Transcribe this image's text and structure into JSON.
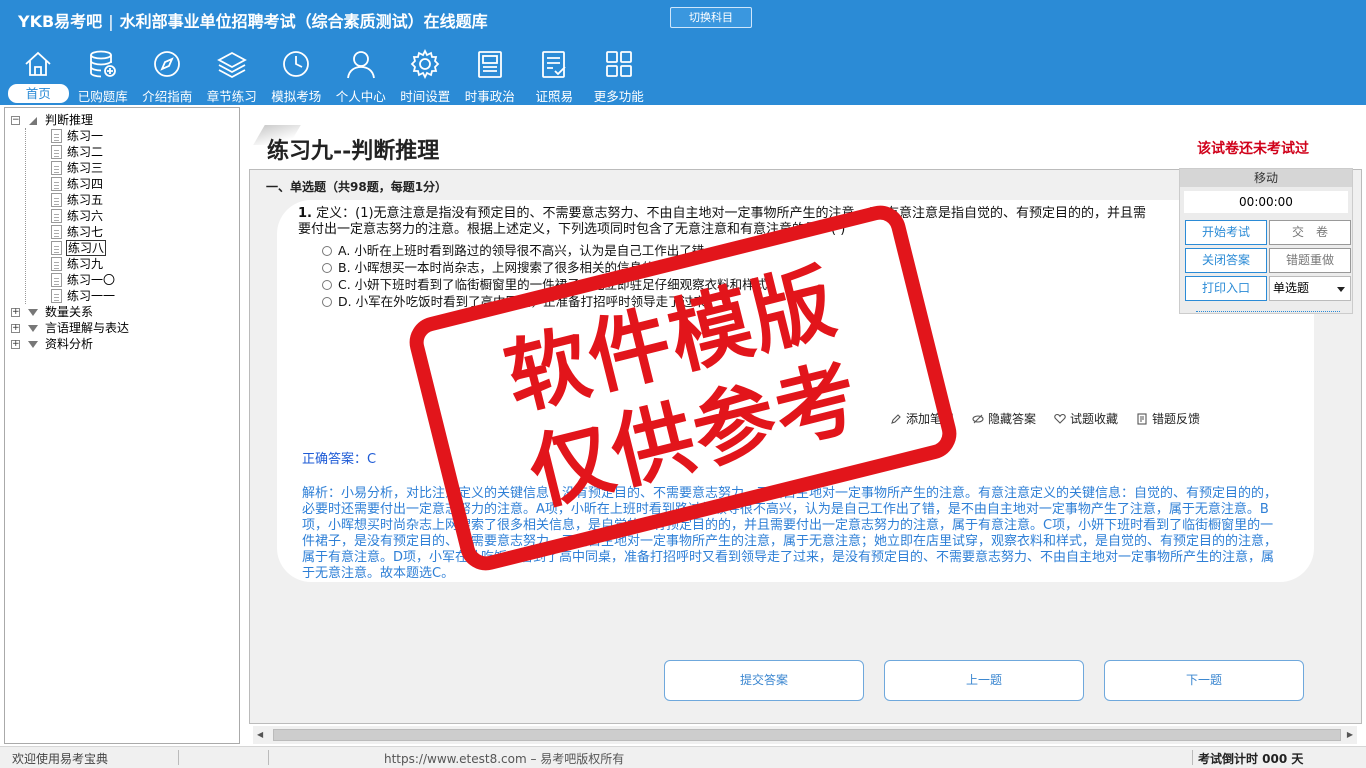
{
  "header": {
    "brand": "YKB易考吧",
    "separator": "|",
    "title": "水利部事业单位招聘考试（综合素质测试）在线题库",
    "switch_subject": "切换科目",
    "nav": [
      {
        "label": "首页",
        "icon": "home-icon"
      },
      {
        "label": "已购题库",
        "icon": "database-icon"
      },
      {
        "label": "介绍指南",
        "icon": "compass-icon"
      },
      {
        "label": "章节练习",
        "icon": "layers-icon"
      },
      {
        "label": "模拟考场",
        "icon": "clock-icon"
      },
      {
        "label": "个人中心",
        "icon": "user-icon"
      },
      {
        "label": "时间设置",
        "icon": "gear-icon"
      },
      {
        "label": "时事政治",
        "icon": "news-icon"
      },
      {
        "label": "证照易",
        "icon": "checklist-icon"
      },
      {
        "label": "更多功能",
        "icon": "grid-icon"
      }
    ]
  },
  "sidebar": {
    "root": "判断推理",
    "items": [
      "练习一",
      "练习二",
      "练习三",
      "练习四",
      "练习五",
      "练习六",
      "练习七",
      "练习八",
      "练习九",
      "练习一〇",
      "练习一一"
    ],
    "selected": "练习八",
    "groups": [
      "数量关系",
      "言语理解与表达",
      "资料分析"
    ]
  },
  "exam": {
    "title": "练习九--判断推理",
    "status": "该试卷还未考试过",
    "section": "一、单选题（共98题，每题1分）",
    "question": {
      "number": "1.",
      "text": "定义：(1)无意注意是指没有预定目的、不需要意志努力、不由自主地对一定事物所产生的注意。(2)有意注意是指自觉的、有预定目的的，并且需要付出一定意志努力的注意。根据上述定义，下列选项同时包含了无意注意和有意注意的是：( )",
      "options": [
        "A. 小昕在上班时看到路过的领导很不高兴，认为是自己工作出了错",
        "B. 小晖想买一本时尚杂志，上网搜索了很多相关的信息的",
        "C. 小妍下班时看到了临街橱窗里的一件裙子，她立即驻足仔细观察衣料和样式",
        "D. 小军在外吃饭时看到了高中同桌，正准备打招呼时领导走了过来"
      ]
    },
    "actions": [
      "添加笔记",
      "隐藏答案",
      "试题收藏",
      "错题反馈"
    ],
    "correct_answer": "正确答案：C",
    "analysis": "解析：小易分析，对比注意定义的关键信息：没有预定目的、不需要意志努力、不由自主地对一定事物所产生的注意。有意注意定义的关键信息：自觉的、有预定目的的，必要时还需要付出一定意志努力的注意。A项，小昕在上班时看到路过的领导很不高兴，认为是自己工作出了错，是不由自主地对一定事物产生了注意，属于无意注意。B项，小晖想买时尚杂志上网搜索了很多相关信息，是自觉的、有预定目的的，并且需要付出一定意志努力的注意，属于有意注意。C项，小妍下班时看到了临街橱窗里的一件裙子，是没有预定目的、不需要意志努力、不由自主地对一定事物所产生的注意，属于无意注意；她立即在店里试穿，观察衣料和样式，是自觉的、有预定目的的注意，属于有意注意。D项，小军在外吃饭时看到了高中同桌，准备打招呼时又看到领导走了过来，是没有预定目的、不需要意志努力、不由自主地对一定事物所产生的注意，属于无意注意。故本题选C。"
  },
  "buttons": {
    "submit": "提交答案",
    "prev": "上一题",
    "next": "下一题"
  },
  "timer": {
    "move": "移动",
    "time": "00:00:00",
    "start": "开始考试",
    "submit": "交　卷",
    "close_answer": "关闭答案",
    "redo_wrong": "错题重做",
    "print": "打印入口",
    "type_select": "单选题"
  },
  "stamp": {
    "line1": "软件模版",
    "line2": "仅供参考"
  },
  "status": {
    "welcome": "欢迎使用易考宝典",
    "copyright": "https://www.etest8.com – 易考吧版权所有",
    "countdown": "考试倒计时 000 天"
  },
  "colors": {
    "header": "#2b8bd6",
    "stamp": "#e2151b",
    "status_red": "#d0021b",
    "answer_blue": "#1e5bd6",
    "analysis_blue": "#2e7fd6"
  }
}
